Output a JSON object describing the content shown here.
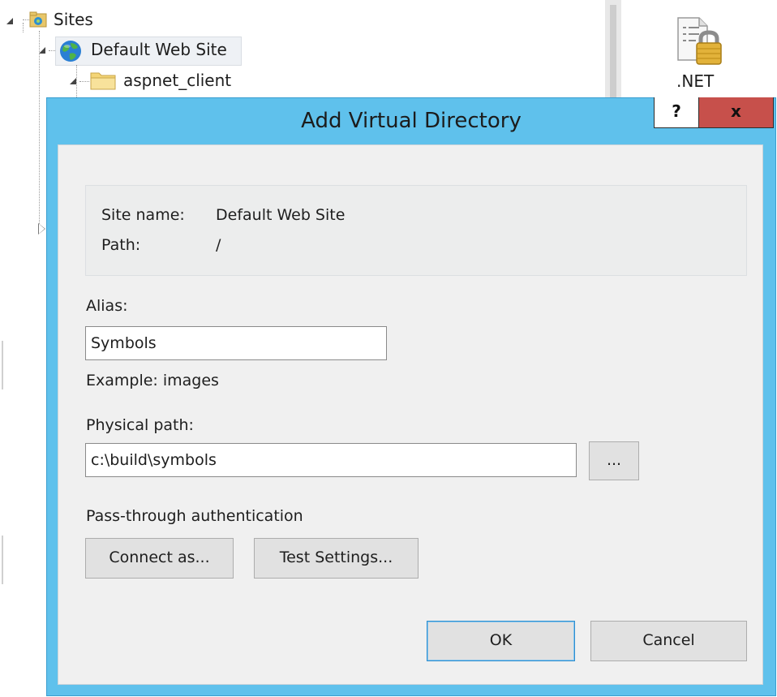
{
  "tree": {
    "sites_label": "Sites",
    "default_site_label": "Default Web Site",
    "aspnet_client_label": "aspnet_client"
  },
  "features": {
    "net_label": ".NET"
  },
  "dialog": {
    "title": "Add Virtual Directory",
    "help_label": "?",
    "close_label": "x",
    "site_name_label": "Site name:",
    "site_name_value": "Default Web Site",
    "path_label": "Path:",
    "path_value": "/",
    "alias_label": "Alias:",
    "alias_value": "Symbols",
    "alias_example": "Example: images",
    "physical_path_label": "Physical path:",
    "physical_path_value": "c:\\build\\symbols",
    "browse_label": "...",
    "pass_through_label": "Pass-through authentication",
    "connect_as_label": "Connect as...",
    "test_settings_label": "Test Settings...",
    "ok_label": "OK",
    "cancel_label": "Cancel"
  },
  "colors": {
    "dialog_frame": "#5fc1ec",
    "close_button": "#c7504b",
    "client_bg": "#f0f0f0",
    "default_button_border": "#2f8fd0"
  }
}
